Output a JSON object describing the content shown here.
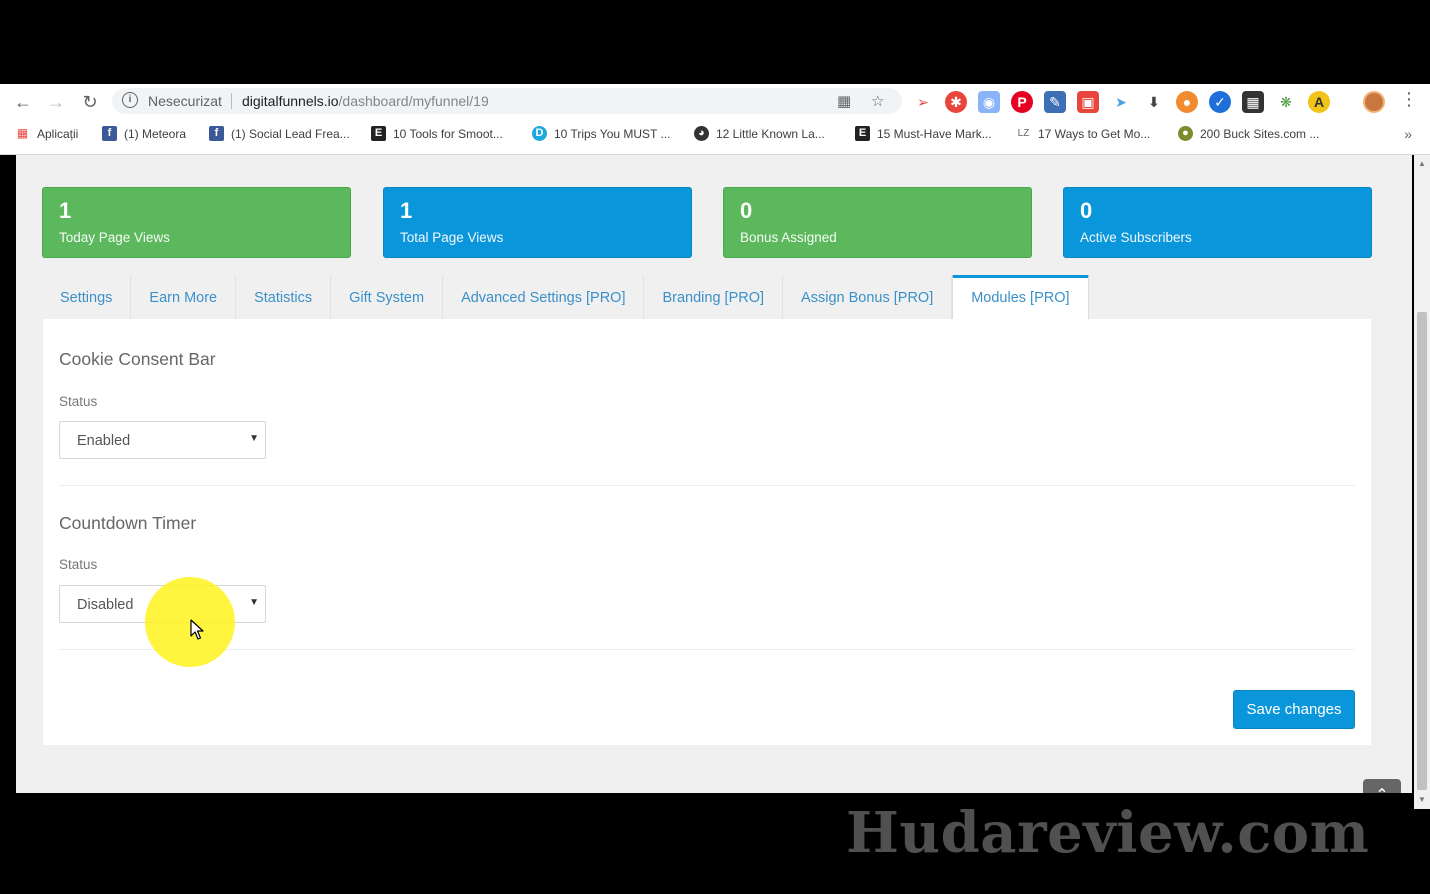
{
  "browser": {
    "address": {
      "security_label": "Nesecurizat",
      "url_host": "digitalfunnels.io",
      "url_path": "/dashboard/myfunnel/19"
    },
    "bookmarks": [
      {
        "label": "Aplicații",
        "icon": "apps-grid-icon"
      },
      {
        "label": "(1) Meteora",
        "icon": "facebook-icon"
      },
      {
        "label": "(1) Social Lead Frea...",
        "icon": "facebook-icon"
      },
      {
        "label": "10 Tools for Smoot...",
        "icon": "e-icon"
      },
      {
        "label": "10 Trips You MUST ...",
        "icon": "d-icon"
      },
      {
        "label": "12 Little Known La...",
        "icon": "gauge-icon"
      },
      {
        "label": "15 Must-Have Mark...",
        "icon": "e-icon"
      },
      {
        "label": "17 Ways to Get Mo...",
        "icon": "lz-icon"
      },
      {
        "label": "200 Buck Sites.com ...",
        "icon": "globe-icon"
      }
    ],
    "colors": {
      "accent": "#0a96da",
      "success": "#5cb85c"
    }
  },
  "stats": [
    {
      "value": "1",
      "label": "Today Page Views",
      "color": "#5cb85c"
    },
    {
      "value": "1",
      "label": "Total Page Views",
      "color": "#0a96da"
    },
    {
      "value": "0",
      "label": "Bonus Assigned",
      "color": "#5cb85c"
    },
    {
      "value": "0",
      "label": "Active Subscribers",
      "color": "#0a96da"
    }
  ],
  "tabs": [
    {
      "label": "Settings"
    },
    {
      "label": "Earn More"
    },
    {
      "label": "Statistics"
    },
    {
      "label": "Gift System"
    },
    {
      "label": "Advanced Settings [PRO]"
    },
    {
      "label": "Branding [PRO]"
    },
    {
      "label": "Assign Bonus [PRO]"
    },
    {
      "label": "Modules [PRO]",
      "active": true
    }
  ],
  "modules": {
    "cookie": {
      "title": "Cookie Consent Bar",
      "status_label": "Status",
      "status_value": "Enabled"
    },
    "countdown": {
      "title": "Countdown Timer",
      "status_label": "Status",
      "status_value": "Disabled"
    },
    "save_label": "Save changes"
  },
  "watermark": "Hudareview.com"
}
